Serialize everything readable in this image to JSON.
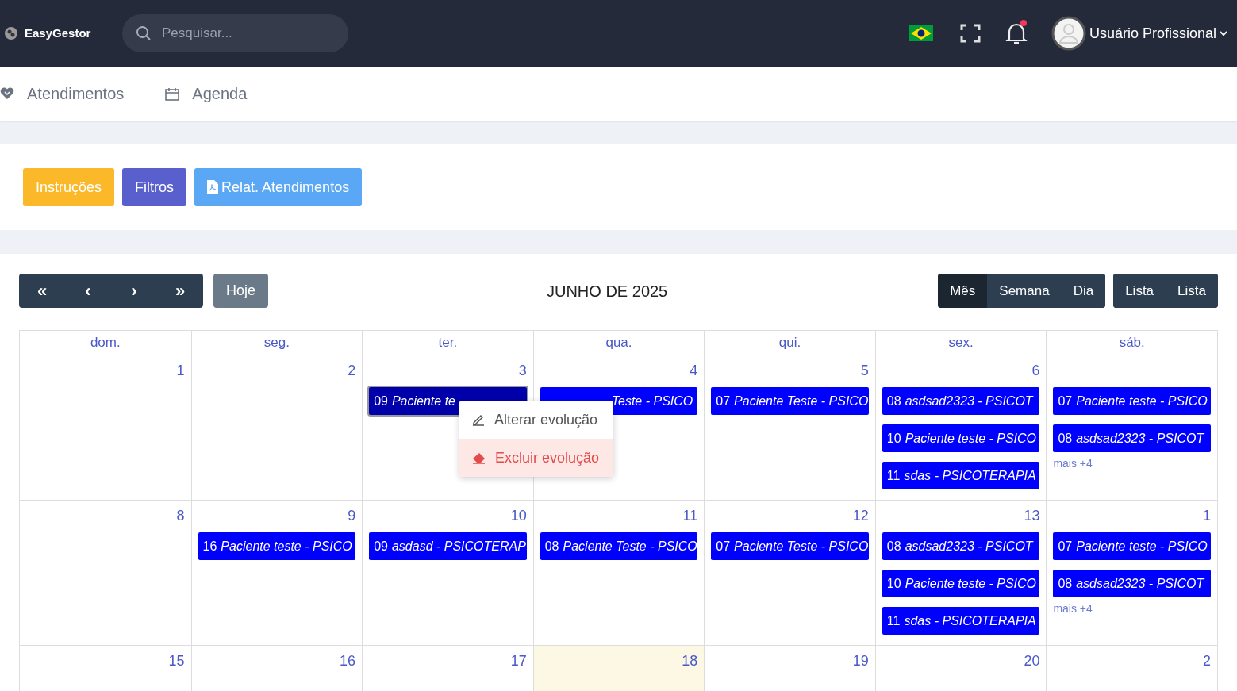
{
  "brand": "EasyGestor",
  "search": {
    "placeholder": "Pesquisar..."
  },
  "user": {
    "name": "Usuário Profissional",
    "notification": true
  },
  "nav": [
    {
      "kind": "heart",
      "label": "Atendimentos"
    },
    {
      "kind": "calendar",
      "label": "Agenda"
    }
  ],
  "actions": [
    {
      "kind": "warning",
      "label": "Instruções"
    },
    {
      "kind": "indigo",
      "label": "Filtros"
    },
    {
      "kind": "report",
      "label": "Relat. Atendimentos"
    }
  ],
  "calendar": {
    "nav_buttons": [
      "«",
      "‹",
      "›",
      "»"
    ],
    "today_button": "Hoje",
    "title": "JUNHO DE 2025",
    "views": [
      {
        "label": "Mês",
        "selected": true
      },
      {
        "label": "Semana",
        "selected": false
      },
      {
        "label": "Dia",
        "selected": false
      }
    ],
    "lists": [
      {
        "label": "Lista",
        "selected": false
      },
      {
        "label": "Lista",
        "selected": false
      }
    ],
    "weekdays": [
      "dom.",
      "seg.",
      "ter.",
      "qua.",
      "qui.",
      "sex.",
      "sáb."
    ],
    "weeks": [
      {
        "days": [
          {
            "number": "1",
            "today": false
          },
          {
            "number": "2",
            "today": false
          },
          {
            "number": "3",
            "today": false,
            "events": [
              {
                "time": "09",
                "title": "Paciente te",
                "selected": true
              }
            ]
          },
          {
            "number": "4",
            "today": false,
            "events": [
              {
                "title": "Teste - PSICO",
                "selected": false
              }
            ]
          },
          {
            "number": "5",
            "today": false,
            "events": [
              {
                "time": "07",
                "title": "Paciente Teste - PSICO",
                "selected": false
              }
            ]
          },
          {
            "number": "6",
            "today": false,
            "events": [
              {
                "time": "08",
                "title": "asdsad2323 - PSICOT",
                "selected": false
              },
              {
                "time": "10",
                "title": "Paciente teste - PSICO",
                "selected": false
              },
              {
                "time": "11",
                "title": "sdas - PSICOTERAPIA",
                "selected": false
              }
            ]
          },
          {
            "today": false,
            "events": [
              {
                "time": "07",
                "title": "Paciente teste - PSICO",
                "selected": false
              },
              {
                "time": "08",
                "title": "asdsad2323 - PSICOT",
                "selected": false
              }
            ],
            "more": "mais +4"
          }
        ]
      },
      {
        "days": [
          {
            "number": "8",
            "today": false
          },
          {
            "number": "9",
            "today": false,
            "events": [
              {
                "time": "16",
                "title": "Paciente teste - PSICO",
                "selected": false
              }
            ]
          },
          {
            "number": "10",
            "today": false,
            "events": [
              {
                "time": "09",
                "title": "asdasd - PSICOTERAP",
                "selected": false
              }
            ]
          },
          {
            "number": "11",
            "today": false,
            "events": [
              {
                "time": "08",
                "title": "Paciente Teste - PSICO",
                "selected": false
              }
            ]
          },
          {
            "number": "12",
            "today": false,
            "events": [
              {
                "time": "07",
                "title": "Paciente Teste - PSICO",
                "selected": false
              }
            ]
          },
          {
            "number": "13",
            "today": false,
            "events": [
              {
                "time": "08",
                "title": "asdsad2323 - PSICOT",
                "selected": false
              },
              {
                "time": "10",
                "title": "Paciente teste - PSICO",
                "selected": false
              },
              {
                "time": "11",
                "title": "sdas - PSICOTERAPIA",
                "selected": false
              }
            ]
          },
          {
            "number": "1",
            "today": false,
            "events": [
              {
                "time": "07",
                "title": "Paciente teste - PSICO",
                "selected": false
              },
              {
                "time": "08",
                "title": "asdsad2323 - PSICOT",
                "selected": false
              }
            ],
            "more": "mais +4"
          }
        ]
      },
      {
        "days": [
          {
            "number": "15",
            "today": false
          },
          {
            "number": "16",
            "today": false
          },
          {
            "number": "17",
            "today": false
          },
          {
            "number": "18",
            "today": true
          },
          {
            "number": "19",
            "today": false
          },
          {
            "number": "20",
            "today": false
          },
          {
            "number": "2",
            "today": false
          }
        ]
      }
    ],
    "context_menu": [
      {
        "kind": "edit",
        "label": "Alterar evolução"
      },
      {
        "kind": "delete",
        "label": "Excluir evolução"
      }
    ]
  }
}
